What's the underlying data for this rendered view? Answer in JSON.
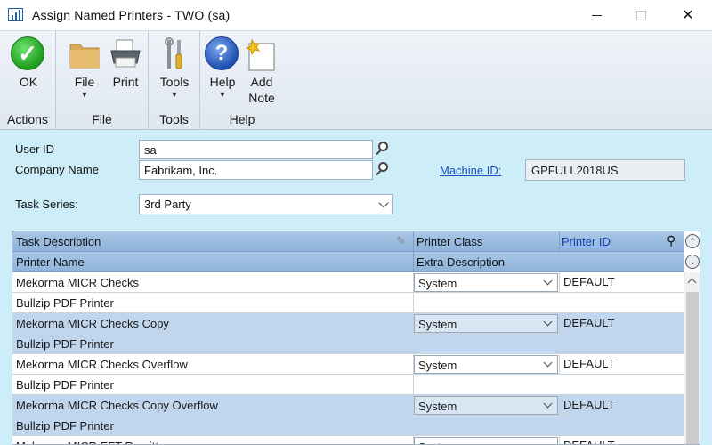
{
  "window": {
    "title": "Assign Named Printers  -  TWO (sa)",
    "minimize": "",
    "maximize": "",
    "close": "✕"
  },
  "ribbon": {
    "groups": [
      {
        "label": "Actions",
        "buttons": [
          {
            "label": "OK",
            "icon": "ok-checkmark-icon"
          }
        ]
      },
      {
        "label": "File",
        "buttons": [
          {
            "label": "File",
            "icon": "folder-icon",
            "has_dropdown": true
          },
          {
            "label": "Print",
            "icon": "printer-icon"
          }
        ]
      },
      {
        "label": "Tools",
        "buttons": [
          {
            "label": "Tools",
            "icon": "tools-icon",
            "has_dropdown": true
          }
        ]
      },
      {
        "label": "Help",
        "buttons": [
          {
            "label": "Help",
            "icon": "help-icon",
            "has_dropdown": true
          },
          {
            "label_line1": "Add",
            "label_line2": "Note",
            "icon": "add-note-icon"
          }
        ]
      }
    ]
  },
  "form": {
    "user_id_label": "User ID",
    "user_id_value": "sa",
    "company_label": "Company Name",
    "company_value": "Fabrikam, Inc.",
    "machine_id_label": "Machine ID:",
    "machine_id_value": "GPFULL2018US",
    "task_series_label": "Task Series:",
    "task_series_value": "3rd Party"
  },
  "grid": {
    "header1": {
      "task_description": "Task Description",
      "printer_class": "Printer Class",
      "printer_id": "Printer ID"
    },
    "header2": {
      "printer_name": "Printer Name",
      "extra_description": "Extra Description"
    },
    "rows": [
      {
        "text": "Mekorma MICR Checks",
        "class": "System",
        "printer_id": "DEFAULT",
        "alt": false,
        "kind": "task"
      },
      {
        "text": "Bullzip PDF Printer",
        "alt": false,
        "kind": "printer"
      },
      {
        "text": "Mekorma MICR Checks Copy",
        "class": "System",
        "printer_id": "DEFAULT",
        "alt": true,
        "kind": "task"
      },
      {
        "text": "Bullzip PDF Printer",
        "alt": true,
        "kind": "printer"
      },
      {
        "text": "Mekorma MICR Checks Overflow",
        "class": "System",
        "printer_id": "DEFAULT",
        "alt": false,
        "kind": "task"
      },
      {
        "text": "Bullzip PDF Printer",
        "alt": false,
        "kind": "printer"
      },
      {
        "text": "Mekorma MICR Checks Copy Overflow",
        "class": "System",
        "printer_id": "DEFAULT",
        "alt": true,
        "kind": "task"
      },
      {
        "text": "Bullzip PDF Printer",
        "alt": true,
        "kind": "printer"
      },
      {
        "text": "Mekorma MICR EFT Remittance",
        "class": "System",
        "printer_id": "DEFAULT",
        "alt": false,
        "kind": "task"
      }
    ]
  }
}
